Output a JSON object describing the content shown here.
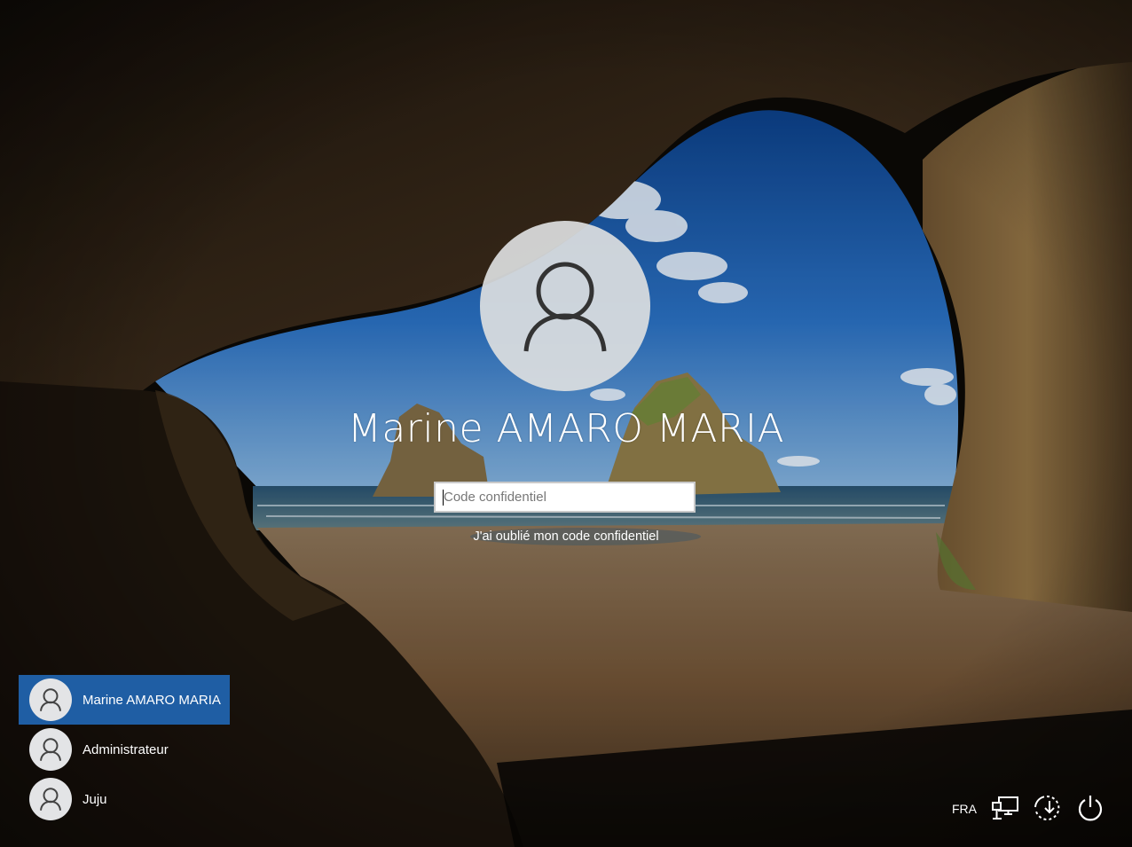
{
  "login": {
    "user_name": "Marine AMARO MARIA",
    "pin_placeholder": "Code confidentiel",
    "pin_value": "",
    "forgot_link": "J'ai oublié mon code confidentiel"
  },
  "user_list": [
    {
      "name": "Marine AMARO MARIA",
      "selected": true
    },
    {
      "name": "Administrateur",
      "selected": false
    },
    {
      "name": "Juju",
      "selected": false
    }
  ],
  "tray": {
    "language": "FRA",
    "icons": [
      "network-icon",
      "ease-of-access-icon",
      "power-icon"
    ]
  },
  "colors": {
    "selected_user_bg": "#1f5ea4",
    "avatar_bg": "#dcdee0",
    "text": "#ffffff"
  }
}
